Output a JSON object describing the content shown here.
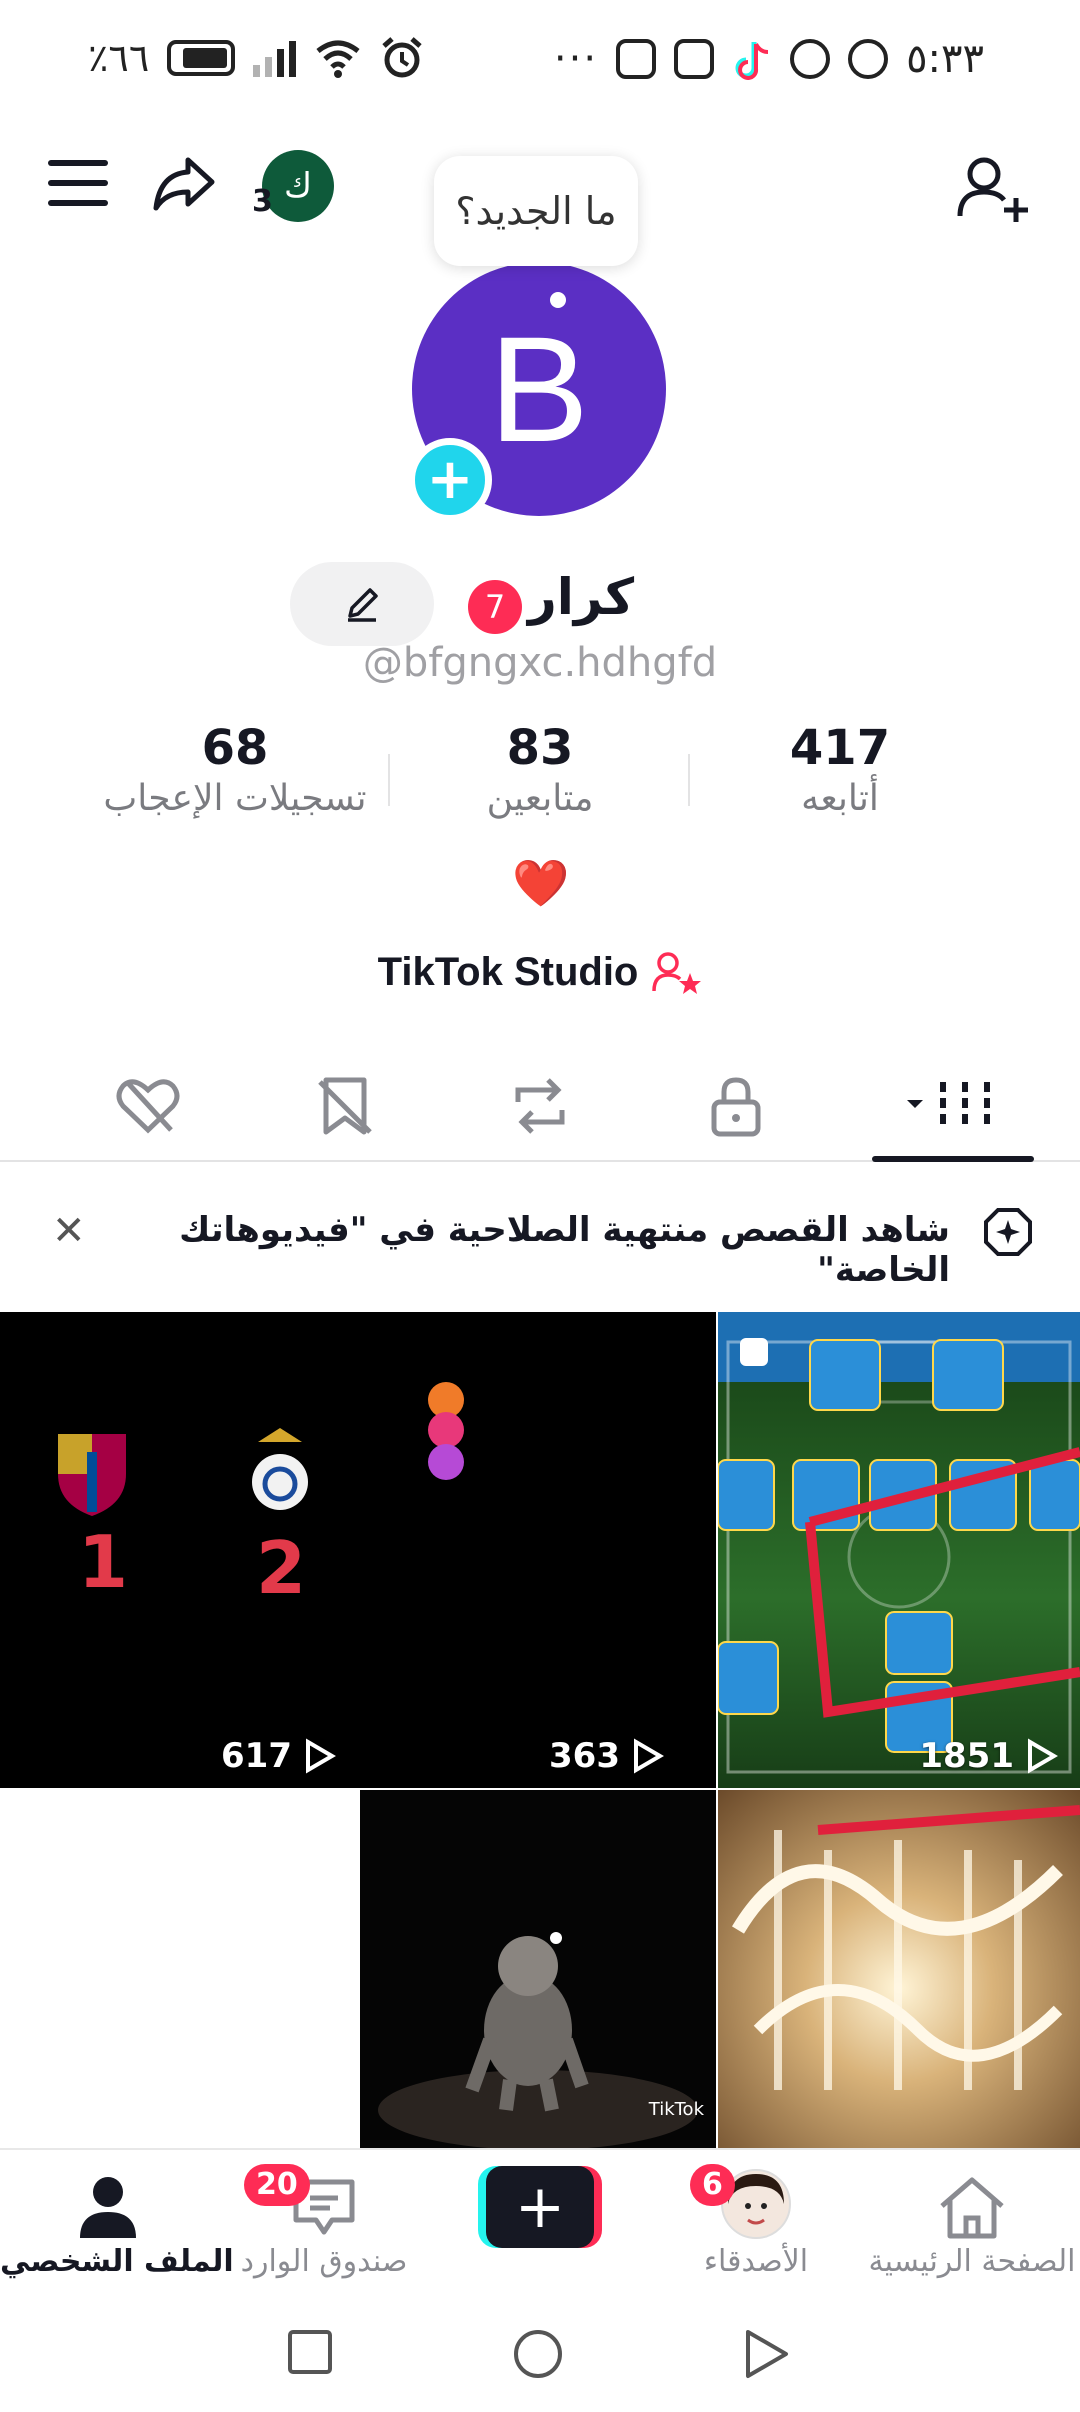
{
  "status_bar": {
    "battery_text": "٪٦٦",
    "time": "٥:٣٣",
    "more": "···",
    "notification_icons": [
      "instagram-icon",
      "instagram-icon",
      "tiktok-icon",
      "messenger-icon",
      "messenger-icon"
    ]
  },
  "header": {
    "small_avatar_letter": "ك",
    "small_avatar_count": "3",
    "tooltip": "ما الجديد؟"
  },
  "profile": {
    "avatar_letter": "B",
    "name": "كرار",
    "name_badge": "7",
    "username": "@bfgngxc.hdhgfd",
    "bio": "❤️",
    "studio_label": "TikTok Studio"
  },
  "stats": {
    "likes": {
      "value": "68",
      "label": "تسجيلات الإعجاب"
    },
    "followers": {
      "value": "83",
      "label": "متابعين"
    },
    "following": {
      "value": "417",
      "label": "أتابعه"
    }
  },
  "tabs": [
    "videos-tab",
    "private-tab",
    "reposts-tab",
    "favorites-tab",
    "liked-tab"
  ],
  "banner": {
    "text": "شاهد القصص منتهية الصلاحية في \"فيديوهاتك الخاصة\""
  },
  "grid": {
    "videos": [
      {
        "views": "1851"
      },
      {
        "views": "363"
      },
      {
        "views": "617"
      }
    ],
    "tiktok_watermark": "TikTok"
  },
  "cell_text": {
    "numbers": [
      "1",
      "2"
    ]
  },
  "bottom_nav": {
    "home": "الصفحة الرئيسية",
    "friends": "الأصدقاء",
    "friends_badge": "6",
    "inbox": "صندوق الوارد",
    "inbox_badge": "20",
    "profile": "الملف الشخصي"
  },
  "colors": {
    "accent": "#fe2c55",
    "cyan": "#25f4ee",
    "avatar_bg": "#5b2fc4"
  }
}
